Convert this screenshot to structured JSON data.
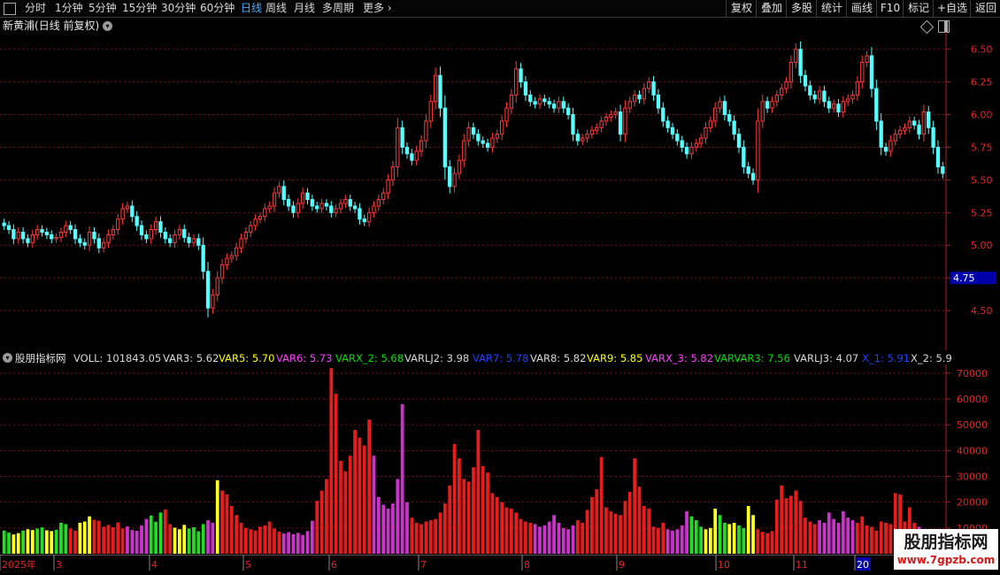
{
  "toolbar": {
    "periods": [
      "分时",
      "1分钟",
      "5分钟",
      "15分钟",
      "30分钟",
      "60分钟",
      "日线",
      "周线",
      "月线",
      "多周期",
      "更多"
    ],
    "active_period": "日线",
    "actions": [
      "复权",
      "叠加",
      "多股",
      "统计",
      "画线",
      "F10",
      "标记",
      "+自选",
      "返回"
    ]
  },
  "stock": {
    "name": "新黄浦",
    "mode": "(日线 前复权)"
  },
  "price_panel": {
    "axis_ticks": [
      "6.50",
      "6.25",
      "6.00",
      "5.75",
      "5.50",
      "5.25",
      "5.00",
      "4.75",
      "4.50"
    ],
    "highlight_label": "4.75",
    "highlight_value": 4.75
  },
  "indicator": {
    "name": "股朋指标网",
    "items": [
      {
        "text": "VOLL: 101843.05",
        "color": "#d8d8d8"
      },
      {
        "text": "VAR3: 5.62",
        "color": "#d8d8d8"
      },
      {
        "text": "VAR5: 5.70",
        "color": "#ffff00"
      },
      {
        "text": "VAR6: 5.73",
        "color": "#ff40ff"
      },
      {
        "text": "VARX_2: 5.68",
        "color": "#00e000"
      },
      {
        "text": "VARLJ2: 3.98",
        "color": "#d8d8d8"
      },
      {
        "text": "VAR7: 5.78",
        "color": "#2040ff"
      },
      {
        "text": "VAR8: 5.82",
        "color": "#d8d8d8"
      },
      {
        "text": "VAR9: 5.85",
        "color": "#ffff00"
      },
      {
        "text": "VARX_3: 5.82",
        "color": "#ff40ff"
      },
      {
        "text": "VARVAR3: 7.56",
        "color": "#00e000"
      },
      {
        "text": "VARLJ3: 4.07",
        "color": "#d8d8d8"
      },
      {
        "text": "X_1: 5.91",
        "color": "#2040ff"
      },
      {
        "text": "X_2: 5.9",
        "color": "#d8d8d8"
      }
    ],
    "axis_ticks": [
      "70000",
      "60000",
      "50000",
      "40000",
      "30000",
      "20000",
      "10000"
    ]
  },
  "date_axis": {
    "labels": [
      "2025年",
      "3",
      "4",
      "5",
      "6",
      "7",
      "8",
      "9",
      "10",
      "11",
      "20"
    ]
  },
  "watermark": {
    "title": "股朋指标网",
    "url": "www.7gpzb.com"
  },
  "colors": {
    "up": "#ff3a3a",
    "down": "#54ffff",
    "grid": "#7a1010",
    "axis": "#aa2020",
    "vol_red": "#e81c1c",
    "vol_green": "#22dd22",
    "vol_yellow": "#ffff20",
    "vol_magenta": "#cc33cc",
    "highlight_bg": "#0000aa"
  },
  "chart_data": {
    "type": "candlestick",
    "price_ylim": [
      4.25,
      6.62
    ],
    "volume_ylim": [
      0,
      72000
    ],
    "closes": [
      5.15,
      5.12,
      5.05,
      5.1,
      5.05,
      5.02,
      5.08,
      5.12,
      5.1,
      5.08,
      5.05,
      5.06,
      5.1,
      5.15,
      5.12,
      5.05,
      5.02,
      5.0,
      5.1,
      5.05,
      4.98,
      5.02,
      5.08,
      5.12,
      5.2,
      5.28,
      5.3,
      5.22,
      5.15,
      5.08,
      5.05,
      5.12,
      5.18,
      5.1,
      5.05,
      5.02,
      5.08,
      5.12,
      5.06,
      5.02,
      5.05,
      5.0,
      4.8,
      4.52,
      4.62,
      4.75,
      4.85,
      4.9,
      4.92,
      4.98,
      5.05,
      5.1,
      5.15,
      5.2,
      5.22,
      5.28,
      5.3,
      5.4,
      5.45,
      5.35,
      5.3,
      5.25,
      5.32,
      5.4,
      5.35,
      5.3,
      5.28,
      5.32,
      5.3,
      5.25,
      5.28,
      5.32,
      5.35,
      5.3,
      5.28,
      5.2,
      5.18,
      5.25,
      5.3,
      5.35,
      5.4,
      5.5,
      5.6,
      5.9,
      5.75,
      5.7,
      5.65,
      5.72,
      5.8,
      5.95,
      6.1,
      6.3,
      6.05,
      5.6,
      5.45,
      5.55,
      5.65,
      5.8,
      5.9,
      5.85,
      5.8,
      5.78,
      5.75,
      5.82,
      5.85,
      5.95,
      6.05,
      6.15,
      6.35,
      6.25,
      6.15,
      6.1,
      6.08,
      6.12,
      6.1,
      6.08,
      6.05,
      6.1,
      6.05,
      6.0,
      5.85,
      5.8,
      5.82,
      5.85,
      5.88,
      5.9,
      5.95,
      5.98,
      6.0,
      6.02,
      5.85,
      6.05,
      6.1,
      6.15,
      6.12,
      6.2,
      6.25,
      6.15,
      6.05,
      5.95,
      5.9,
      5.85,
      5.8,
      5.75,
      5.7,
      5.75,
      5.78,
      5.82,
      5.9,
      5.95,
      6.05,
      6.1,
      6.0,
      5.95,
      5.85,
      5.75,
      5.6,
      5.55,
      5.5,
      5.95,
      6.1,
      6.05,
      6.1,
      6.15,
      6.2,
      6.25,
      6.4,
      6.5,
      6.3,
      6.22,
      6.15,
      6.12,
      6.18,
      6.1,
      6.05,
      6.08,
      6.02,
      6.1,
      6.12,
      6.15,
      6.25,
      6.4,
      6.45,
      6.2,
      5.95,
      5.75,
      5.72,
      5.8,
      5.85,
      5.88,
      5.9,
      5.95,
      5.92,
      5.85,
      6.02,
      5.9,
      5.75,
      5.6,
      5.55
    ],
    "volumes": [
      9000,
      8200,
      7500,
      8000,
      9000,
      9500,
      9200,
      9800,
      10200,
      9100,
      8800,
      9300,
      12000,
      11500,
      9800,
      9000,
      12000,
      12500,
      14500,
      13200,
      12800,
      10500,
      11200,
      10300,
      12100,
      9800,
      10600,
      9200,
      8900,
      11000,
      13500,
      14800,
      12400,
      16000,
      17200,
      11500,
      10100,
      9500,
      11200,
      9800,
      10300,
      8700,
      11500,
      13000,
      12000,
      28500,
      24500,
      23000,
      18500,
      15000,
      12000,
      10000,
      9500,
      9000,
      10500,
      11000,
      12500,
      9800,
      8600,
      7900,
      8400,
      7600,
      8100,
      7300,
      8800,
      12800,
      20500,
      24500,
      29000,
      72000,
      62000,
      36000,
      32000,
      38000,
      48000,
      45000,
      42000,
      52000,
      38000,
      22000,
      19000,
      17500,
      19500,
      29000,
      58000,
      20000,
      14000,
      12000,
      11500,
      12500,
      13000,
      13500,
      16000,
      19500,
      26500,
      42500,
      37000,
      29000,
      28000,
      33500,
      48000,
      34000,
      31500,
      23500,
      22000,
      20000,
      18000,
      17500,
      16000,
      13500,
      12500,
      12000,
      11500,
      10500,
      11000,
      12500,
      15000,
      12000,
      10000,
      9500,
      11000,
      13000,
      12000,
      17000,
      22000,
      25000,
      37500,
      18000,
      16500,
      15500,
      15000,
      20500,
      24000,
      37000,
      26000,
      18500,
      17500,
      10500,
      10000,
      12000,
      9500,
      9000,
      9500,
      11000,
      16500,
      14500,
      13000,
      10500,
      9500,
      10000,
      17500,
      15000,
      12000,
      11500,
      12000,
      11000,
      10000,
      18500,
      15000,
      9500,
      8500,
      8000,
      8800,
      21000,
      26500,
      21500,
      22500,
      24500,
      20500,
      14000,
      12500,
      11500,
      13000,
      12000,
      16000,
      13500,
      12000,
      16500,
      14000,
      13000,
      12000,
      14500,
      11000,
      10500,
      9000,
      12500,
      12000,
      11500,
      23500,
      23000,
      12500,
      18000,
      12000,
      10500,
      8500,
      7500,
      8800
    ],
    "volume_color_codes": [
      "g",
      "g",
      "y",
      "y",
      "g",
      "y",
      "y",
      "g",
      "g",
      "y",
      "y",
      "g",
      "g",
      "g",
      "r",
      "r",
      "y",
      "y",
      "y",
      "r",
      "r",
      "r",
      "r",
      "r",
      "r",
      "r",
      "m",
      "m",
      "m",
      "m",
      "m",
      "g",
      "g",
      "g",
      "r",
      "r",
      "y",
      "y",
      "y",
      "g",
      "g",
      "g",
      "g",
      "m",
      "m",
      "y",
      "r",
      "r",
      "r",
      "r",
      "r",
      "r",
      "r",
      "r",
      "r",
      "r",
      "r",
      "r",
      "r",
      "m",
      "m",
      "m",
      "m",
      "m",
      "m",
      "m",
      "r",
      "r",
      "r",
      "r",
      "r",
      "r",
      "r",
      "r",
      "r",
      "r",
      "r",
      "r",
      "m",
      "m",
      "m",
      "m",
      "m",
      "m",
      "m",
      "m",
      "r",
      "r",
      "r",
      "r",
      "r",
      "r",
      "r",
      "r",
      "r",
      "r",
      "r",
      "r",
      "r",
      "r",
      "r",
      "r",
      "r",
      "r",
      "r",
      "r",
      "r",
      "r",
      "r",
      "r",
      "r",
      "r",
      "m",
      "m",
      "m",
      "m",
      "m",
      "m",
      "m",
      "m",
      "m",
      "r",
      "r",
      "r",
      "r",
      "r",
      "r",
      "r",
      "r",
      "r",
      "r",
      "r",
      "r",
      "r",
      "r",
      "r",
      "r",
      "r",
      "r",
      "r",
      "m",
      "m",
      "m",
      "m",
      "m",
      "g",
      "g",
      "g",
      "y",
      "y",
      "y",
      "g",
      "g",
      "y",
      "y",
      "g",
      "g",
      "y",
      "y",
      "r",
      "r",
      "r",
      "r",
      "r",
      "r",
      "r",
      "r",
      "r",
      "r",
      "r",
      "r",
      "r",
      "m",
      "m",
      "m",
      "m",
      "m",
      "m",
      "m",
      "m",
      "r",
      "r",
      "r",
      "r",
      "r",
      "r",
      "r",
      "r",
      "r",
      "r",
      "r",
      "r",
      "r",
      "m",
      "m",
      "m",
      "g",
      "g",
      "g",
      "g",
      "g",
      "g",
      "g",
      "g"
    ]
  }
}
